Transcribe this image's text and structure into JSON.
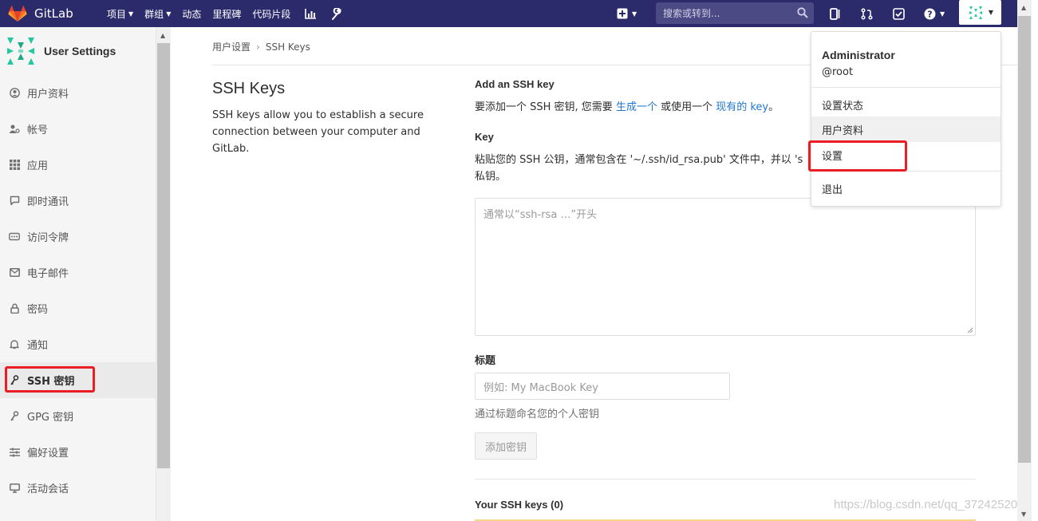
{
  "navbar": {
    "brand": "GitLab",
    "menu": [
      {
        "label": "项目",
        "caret": true
      },
      {
        "label": "群组",
        "caret": true
      },
      {
        "label": "动态",
        "caret": false
      },
      {
        "label": "里程碑",
        "caret": false
      },
      {
        "label": "代码片段",
        "caret": false
      }
    ],
    "search_placeholder": "搜索或转到...",
    "bg_color": "#2b2a6b"
  },
  "sidebar": {
    "title": "User Settings",
    "items": [
      {
        "label": "用户资料",
        "icon": "user-circle-icon"
      },
      {
        "label": "帐号",
        "icon": "account-icon"
      },
      {
        "label": "应用",
        "icon": "applications-grid-icon"
      },
      {
        "label": "即时通讯",
        "icon": "chat-icon"
      },
      {
        "label": "访问令牌",
        "icon": "token-icon"
      },
      {
        "label": "电子邮件",
        "icon": "envelope-icon"
      },
      {
        "label": "密码",
        "icon": "lock-icon"
      },
      {
        "label": "通知",
        "icon": "bell-icon"
      },
      {
        "label": "SSH 密钥",
        "icon": "key-icon",
        "active": true
      },
      {
        "label": "GPG 密钥",
        "icon": "key-icon"
      },
      {
        "label": "偏好设置",
        "icon": "sliders-icon"
      },
      {
        "label": "活动会话",
        "icon": "monitor-icon"
      }
    ]
  },
  "breadcrumb": {
    "parent": "用户设置",
    "current": "SSH Keys"
  },
  "page": {
    "title": "SSH Keys",
    "description": "SSH keys allow you to establish a secure connection between your computer and GitLab."
  },
  "form": {
    "add_title": "Add an SSH key",
    "add_text_before": "要添加一个 SSH 密钥, 您需要 ",
    "add_link1": "生成一个",
    "add_text_mid": " 或使用一个 ",
    "add_link2": "现有的 key",
    "add_text_end": "。",
    "key_label": "Key",
    "key_help_line1": "粘贴您的 SSH 公钥，通常包含在 '~/.ssh/id_rsa.pub' 文件中，并以 's",
    "key_help_line2": "私钥。",
    "key_placeholder": "通常以“ssh-rsa …”开头",
    "title_label": "标题",
    "title_placeholder": "例如: My MacBook Key",
    "title_hint": "通过标题命名您的个人密钥",
    "add_button": "添加密钥",
    "your_keys": "Your SSH keys (0)"
  },
  "dropdown": {
    "name": "Administrator",
    "username": "@root",
    "items": [
      "设置状态",
      "用户资料",
      "设置",
      "退出"
    ]
  },
  "watermark": "https://blog.csdn.net/qq_37242520"
}
